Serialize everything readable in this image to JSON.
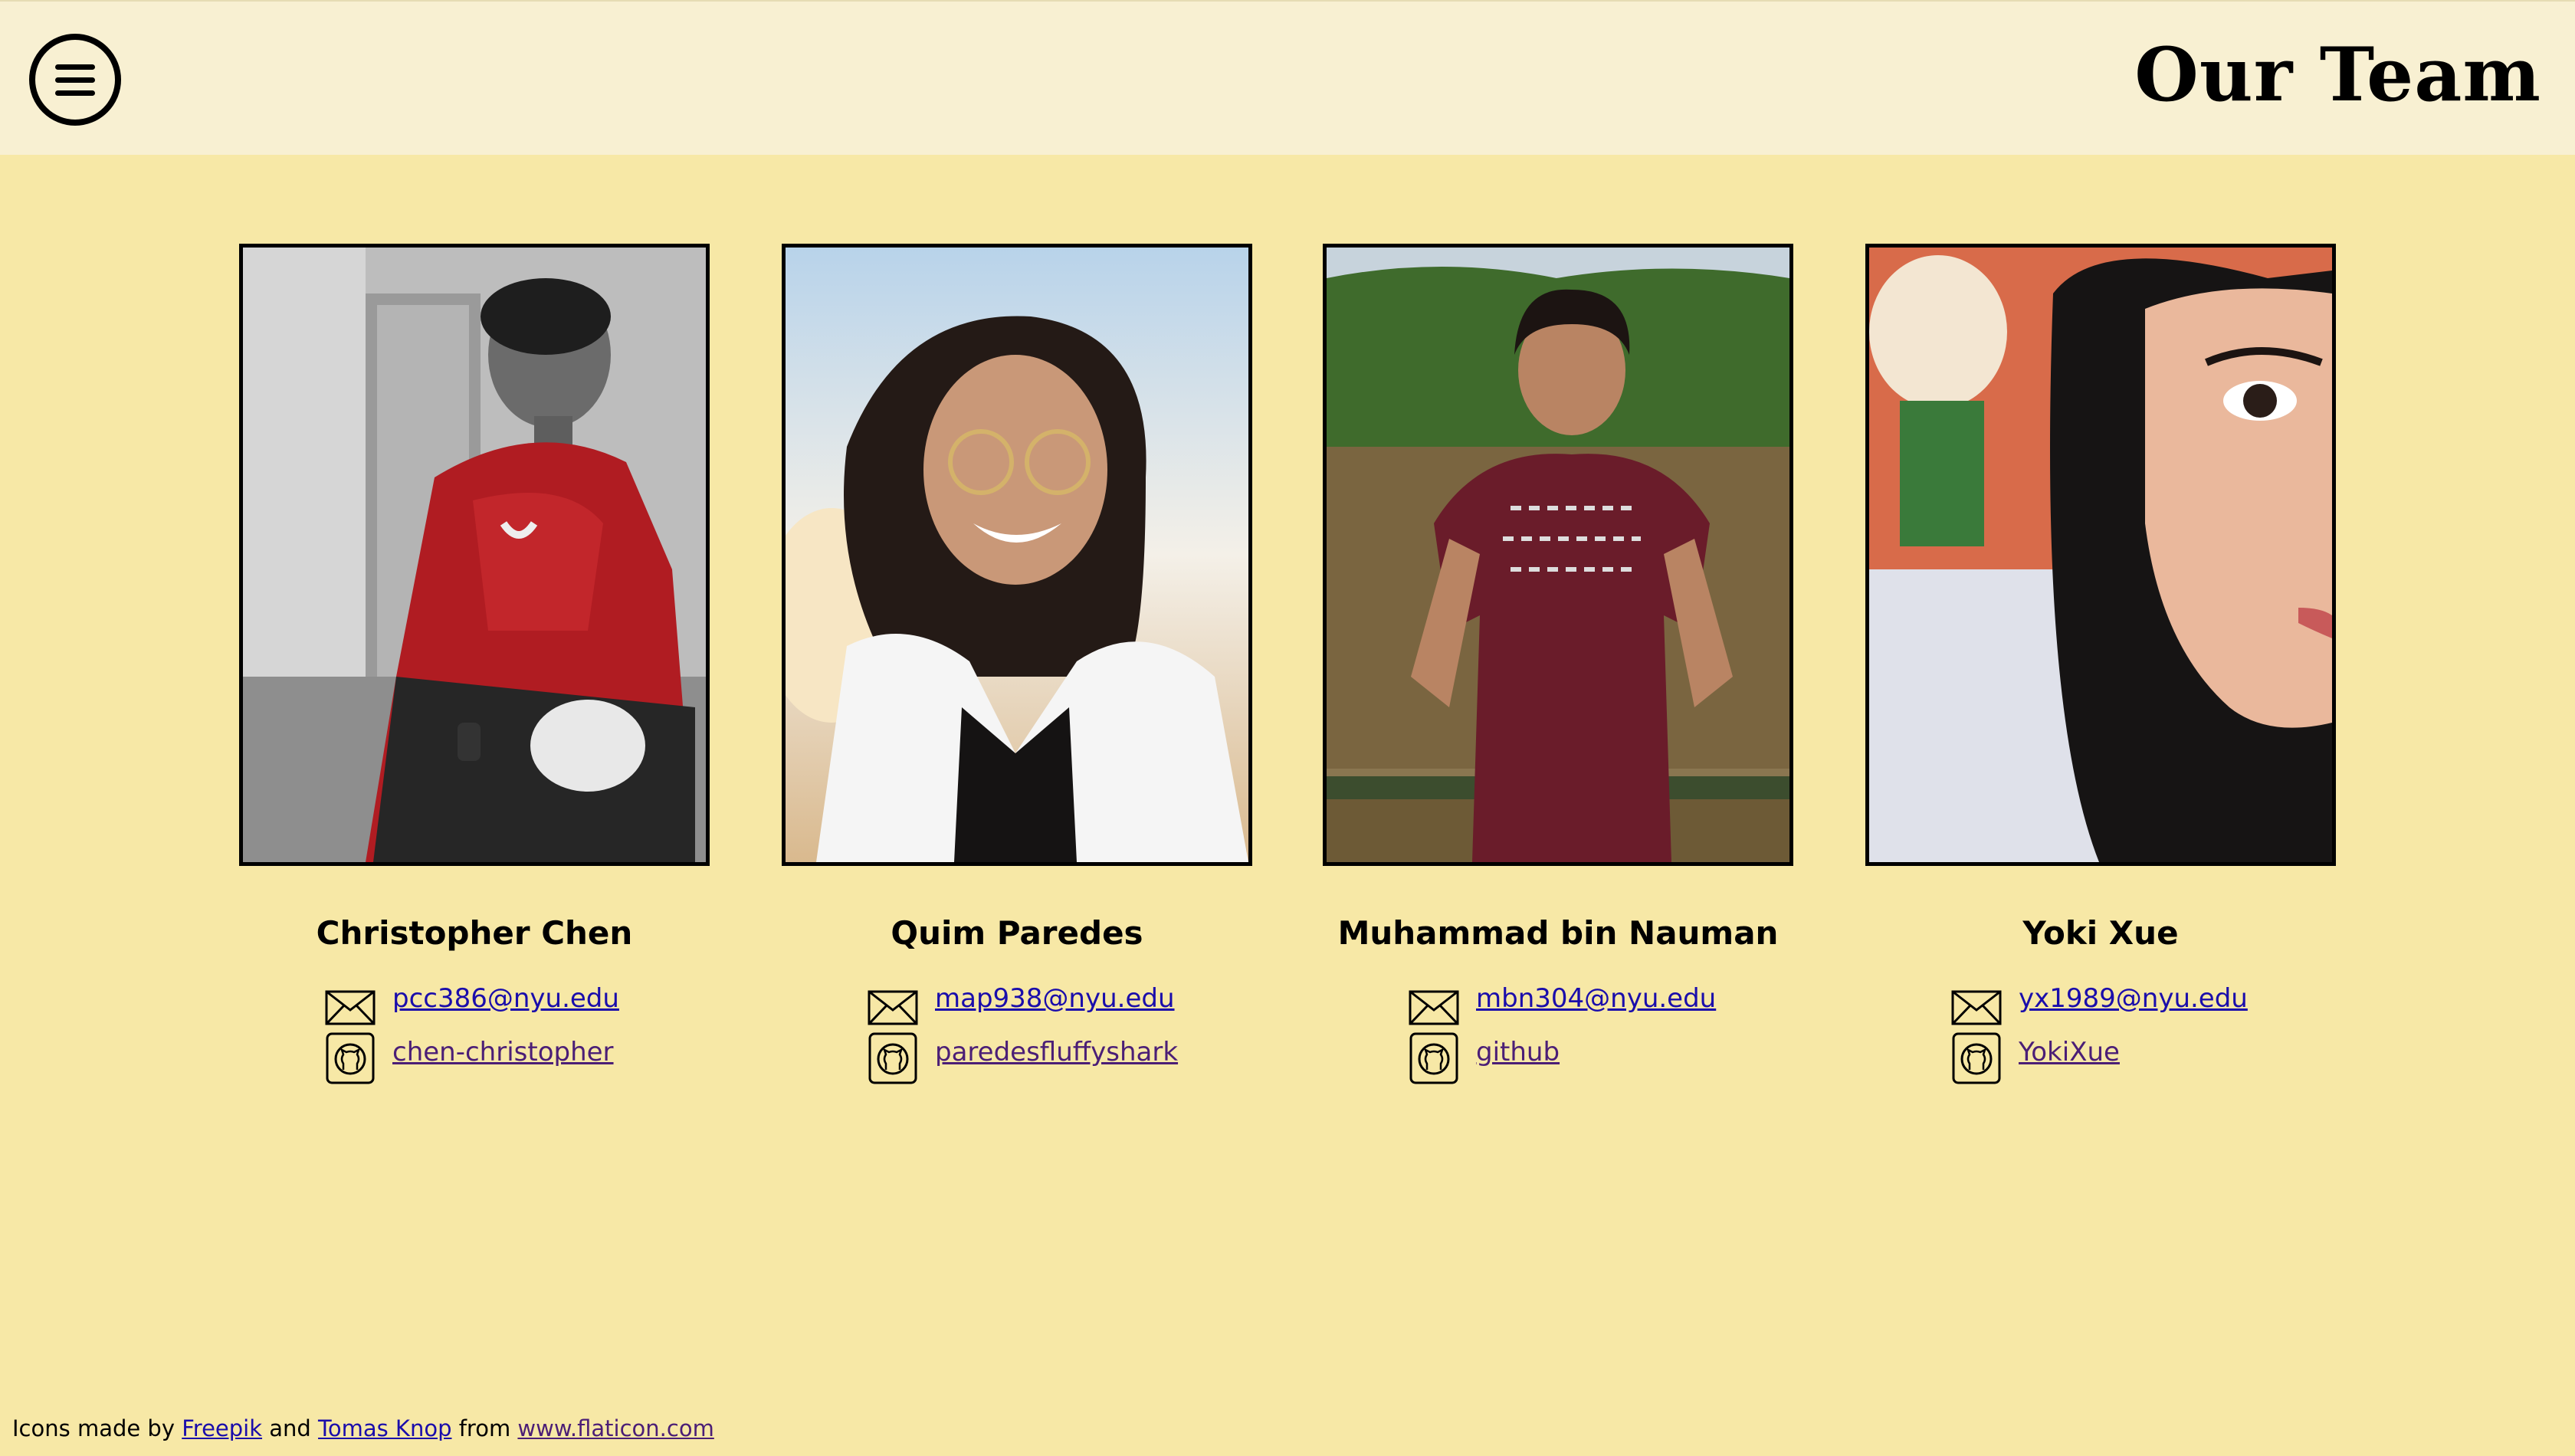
{
  "header": {
    "title": "Our Team",
    "menu_icon": "hamburger-menu-icon"
  },
  "team": [
    {
      "name": "Christopher Chen",
      "email": "pcc386@nyu.edu",
      "github": "chen-christopher",
      "photo_description_colors": [
        "#c8c8c8",
        "#b01c22",
        "#2a2a2a"
      ]
    },
    {
      "name": "Quim Paredes",
      "email": "map938@nyu.edu",
      "github": "paredesfluffyshark",
      "photo_description_colors": [
        "#f1efe9",
        "#ffffff",
        "#1a1616"
      ]
    },
    {
      "name": "Muhammad bin Nauman",
      "email": "mbn304@nyu.edu",
      "github": "github",
      "photo_description_colors": [
        "#3f6b2c",
        "#6d5a36",
        "#6a1c2a"
      ]
    },
    {
      "name": "Yoki Xue",
      "email": "yx1989@nyu.edu",
      "github": "YokiXue",
      "photo_description_colors": [
        "#d86b4a",
        "#eab89c",
        "#151515"
      ]
    }
  ],
  "icons": {
    "email": "envelope-icon",
    "github": "github-icon"
  },
  "footer": {
    "prefix": "Icons made by",
    "author1": "Freepik",
    "and": "and",
    "author2": "Tomas Knop",
    "from": "from",
    "site": "www.flaticon.com"
  },
  "colors": {
    "page_background": "#f7e8a6",
    "header_background": "#f8f0d2",
    "link": "#1a0dab",
    "visited_link": "#4b1e76"
  }
}
